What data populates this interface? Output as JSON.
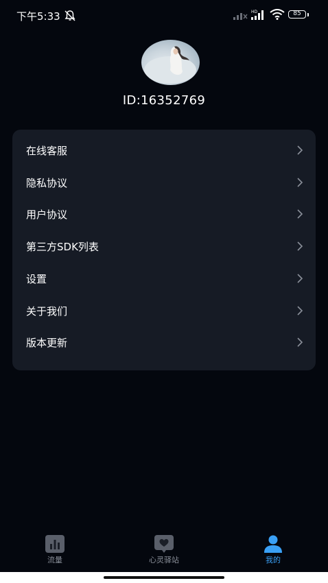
{
  "status_bar": {
    "time": "下午5:33",
    "battery": "85",
    "network_label": "HD"
  },
  "profile": {
    "user_id": "ID:16352769"
  },
  "menu": {
    "items": [
      {
        "label": "在线客服"
      },
      {
        "label": "隐私协议"
      },
      {
        "label": "用户协议"
      },
      {
        "label": "第三方SDK列表"
      },
      {
        "label": "设置"
      },
      {
        "label": "关于我们"
      },
      {
        "label": "版本更新"
      }
    ]
  },
  "tabs": [
    {
      "label": "流量",
      "icon": "bar-chart-icon",
      "active": false
    },
    {
      "label": "心灵驿站",
      "icon": "heart-icon",
      "active": false
    },
    {
      "label": "我的",
      "icon": "person-icon",
      "active": true
    }
  ],
  "colors": {
    "background": "#04070e",
    "card": "#161b25",
    "accent": "#3aa0f5",
    "inactive_tab": "#8a8f99"
  }
}
